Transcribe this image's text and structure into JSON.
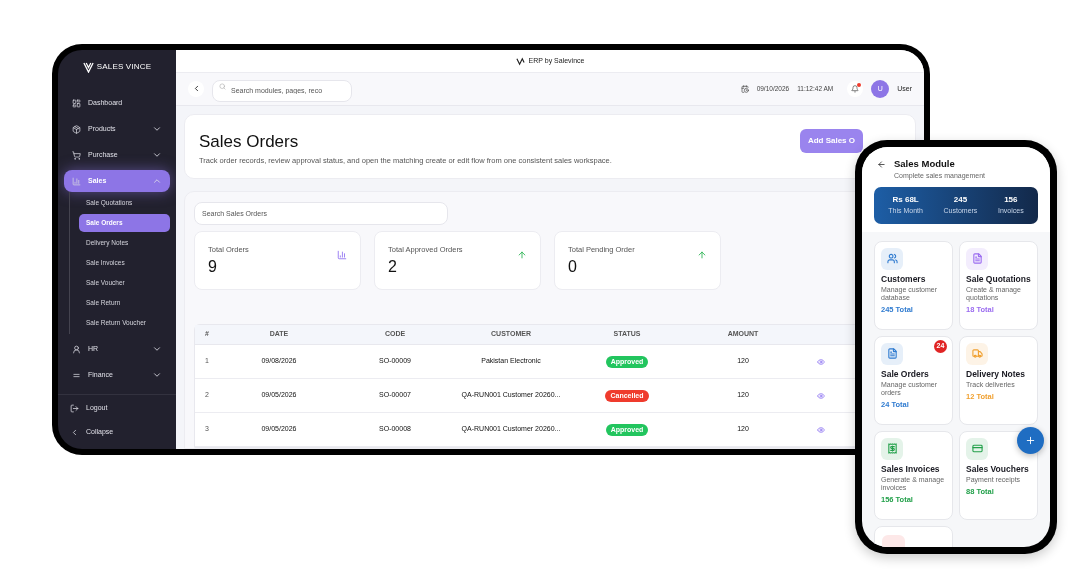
{
  "tablet": {
    "brand": "SALES VINCE",
    "sidebar": {
      "items": [
        {
          "label": "Dashboard",
          "kind": "link",
          "selected": false
        },
        {
          "label": "Products",
          "kind": "group",
          "selected": false,
          "expanded": false
        },
        {
          "label": "Purchase",
          "kind": "group",
          "selected": false,
          "expanded": false
        },
        {
          "label": "Sales",
          "kind": "group",
          "selected": true,
          "expanded": true,
          "children": [
            {
              "label": "Sale Quotations",
              "selected": false
            },
            {
              "label": "Sale Orders",
              "selected": true
            },
            {
              "label": "Delivery Notes",
              "selected": false
            },
            {
              "label": "Sale Invoices",
              "selected": false
            },
            {
              "label": "Sale Voucher",
              "selected": false
            },
            {
              "label": "Sale Return",
              "selected": false
            },
            {
              "label": "Sale Return Voucher",
              "selected": false
            }
          ]
        },
        {
          "label": "HR",
          "kind": "group",
          "selected": false,
          "expanded": false
        },
        {
          "label": "Finance",
          "kind": "group",
          "selected": false,
          "expanded": false
        }
      ],
      "footer": [
        "Logout",
        "Collapse"
      ]
    },
    "app_title": "ERP by Salevince",
    "header": {
      "search": {
        "placeholder": "Search modules, pages, reco"
      },
      "date": "09/10/2026",
      "time": "11:12:42 AM",
      "notifications_unread": true,
      "avatar": "U",
      "user": "User"
    },
    "page": {
      "title": "Sales Orders",
      "description": "Track order records, review approval status, and open the matching create or edit flow from one consistent sales workspace.",
      "action": "Add Sales O"
    },
    "search": {
      "placeholder": "Search Sales Orders"
    },
    "stats": [
      {
        "label": "Total Orders",
        "value": "9"
      },
      {
        "label": "Total Approved Orders",
        "value": "2"
      },
      {
        "label": "Total Pending Order",
        "value": "0"
      }
    ],
    "table": {
      "columns": [
        "#",
        "DATE",
        "CODE",
        "CUSTOMER",
        "STATUS",
        "AMOUNT"
      ],
      "rows": [
        {
          "num": "1",
          "date": "09/08/2026",
          "code": "SO-00009",
          "customer": "Pakistan Electronic",
          "status": {
            "label": "Approved",
            "kind": "approved"
          },
          "amount": "120"
        },
        {
          "num": "2",
          "date": "09/05/2026",
          "code": "SO-00007",
          "customer": "QA-RUN001 Customer 20260...",
          "status": {
            "label": "Cancelled",
            "kind": "cancelled"
          },
          "amount": "120"
        },
        {
          "num": "3",
          "date": "09/05/2026",
          "code": "SO-00008",
          "customer": "QA-RUN001 Customer 20260...",
          "status": {
            "label": "Approved",
            "kind": "approved"
          },
          "amount": "120"
        }
      ]
    }
  },
  "phone": {
    "title": "Sales Module",
    "subtitle": "Complete sales management",
    "summary": [
      {
        "value": "Rs 68L",
        "label": "This Month"
      },
      {
        "value": "245",
        "label": "Customers"
      },
      {
        "value": "156",
        "label": "Invoices"
      }
    ],
    "modules": [
      {
        "title": "Customers",
        "description": "Manage customer database",
        "total": "245 Total",
        "color": "#2f7bd0"
      },
      {
        "title": "Sale Quotations",
        "description": "Create & manage quotations",
        "total": "18 Total",
        "color": "#9b6cf0"
      },
      {
        "title": "Sale Orders",
        "description": "Manage customer orders",
        "total": "24 Total",
        "color": "#2f7bd0",
        "badge": "24"
      },
      {
        "title": "Delivery Notes",
        "description": "Track deliveries",
        "total": "12 Total",
        "color": "#f0a030"
      },
      {
        "title": "Sales Invoices",
        "description": "Generate & manage invoices",
        "total": "156 Total",
        "color": "#22a04a"
      },
      {
        "title": "Sales Vouchers",
        "description": "Payment receipts",
        "total": "88 Total",
        "color": "#22a04a"
      }
    ]
  }
}
